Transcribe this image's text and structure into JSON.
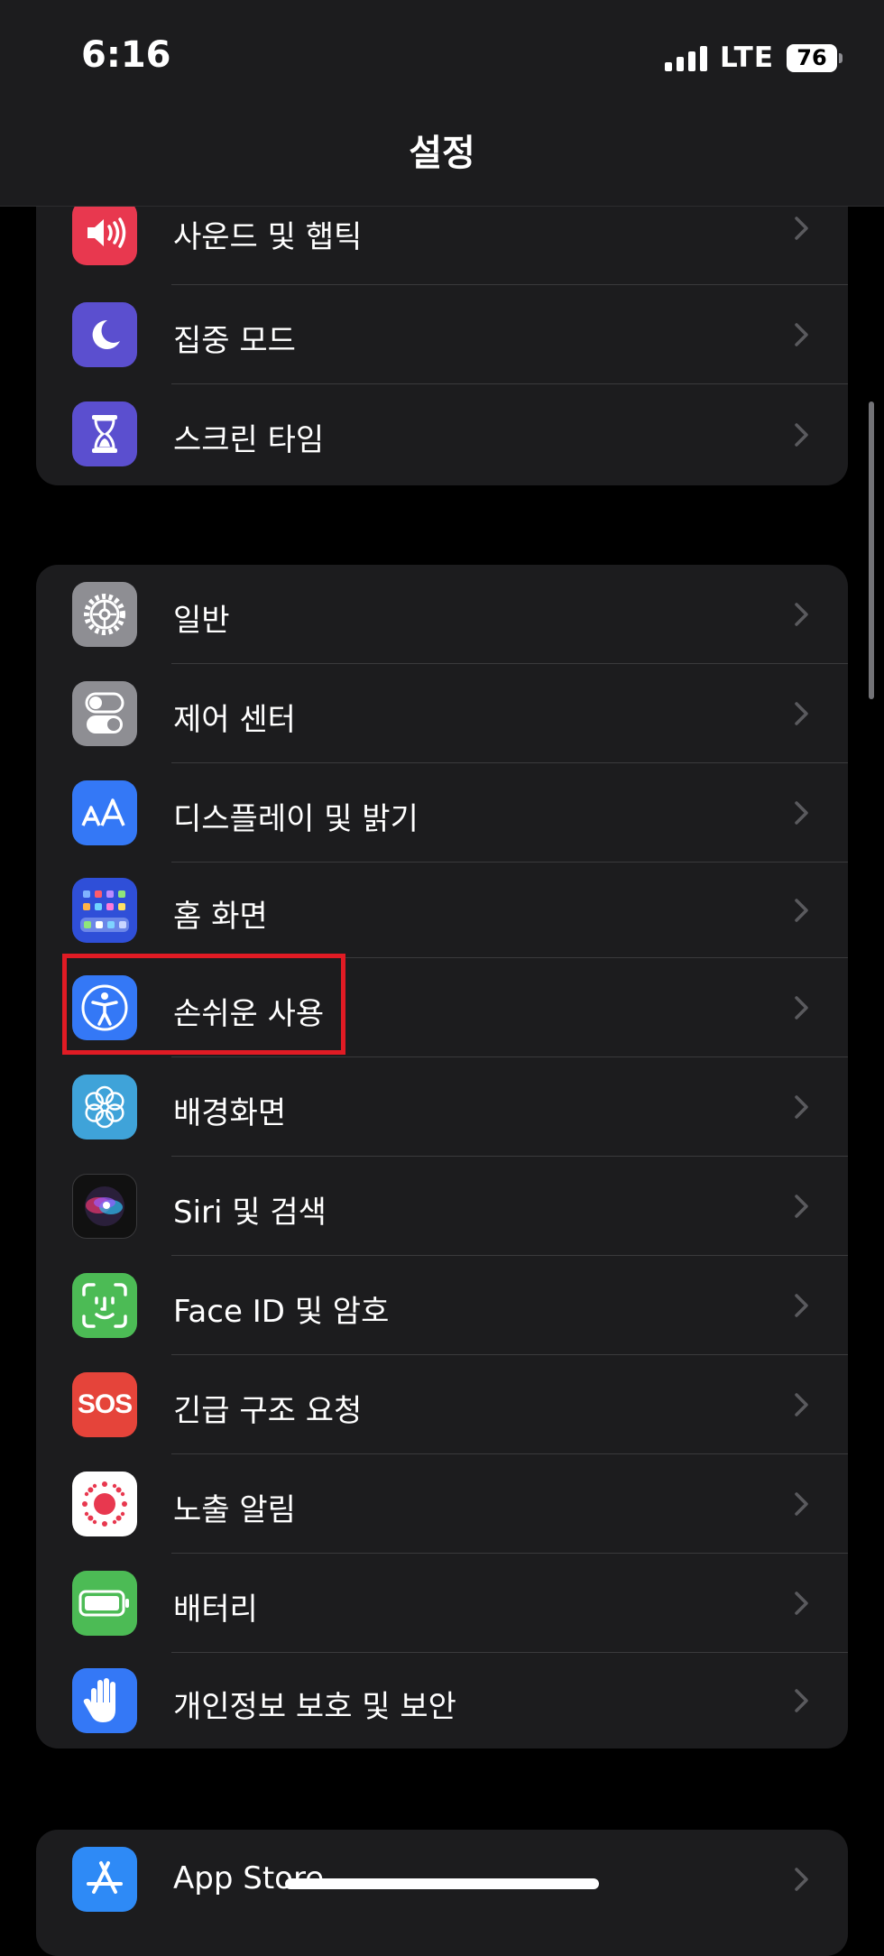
{
  "status_bar": {
    "time": "6:16",
    "network": "LTE",
    "battery": "76"
  },
  "nav": {
    "title": "설정"
  },
  "groups": [
    {
      "items": [
        {
          "label": "사운드 및 햅틱",
          "icon": "speaker-icon",
          "color": "#e8384f"
        },
        {
          "label": "집중 모드",
          "icon": "moon-icon",
          "color": "#5b4fcf"
        },
        {
          "label": "스크린 타임",
          "icon": "hourglass-icon",
          "color": "#5b4fcf"
        }
      ]
    },
    {
      "items": [
        {
          "label": "일반",
          "icon": "gear-icon",
          "color": "#8e8e93"
        },
        {
          "label": "제어 센터",
          "icon": "toggles-icon",
          "color": "#8e8e93"
        },
        {
          "label": "디스플레이 및 밝기",
          "icon": "text-size-icon",
          "color": "#3478f6"
        },
        {
          "label": "홈 화면",
          "icon": "home-grid-icon",
          "color": "#2f4fd8"
        },
        {
          "label": "손쉬운 사용",
          "icon": "accessibility-icon",
          "color": "#3478f6"
        },
        {
          "label": "배경화면",
          "icon": "flower-icon",
          "color": "#3fa3d9"
        },
        {
          "label": "Siri 및 검색",
          "icon": "siri-icon",
          "color": "#1c1c1e"
        },
        {
          "label": "Face ID 및 암호",
          "icon": "face-id-icon",
          "color": "#4cbb55"
        },
        {
          "label": "긴급 구조 요청",
          "icon": "sos-icon",
          "color": "#e5443a",
          "icon_text": "SOS"
        },
        {
          "label": "노출 알림",
          "icon": "exposure-icon",
          "color": "#ffffff"
        },
        {
          "label": "배터리",
          "icon": "battery-icon",
          "color": "#4cbb55"
        },
        {
          "label": "개인정보 보호 및 보안",
          "icon": "hand-icon",
          "color": "#3478f6"
        }
      ]
    },
    {
      "items": [
        {
          "label": "App Store",
          "icon": "app-store-icon",
          "color": "#2e8af6"
        }
      ]
    }
  ]
}
